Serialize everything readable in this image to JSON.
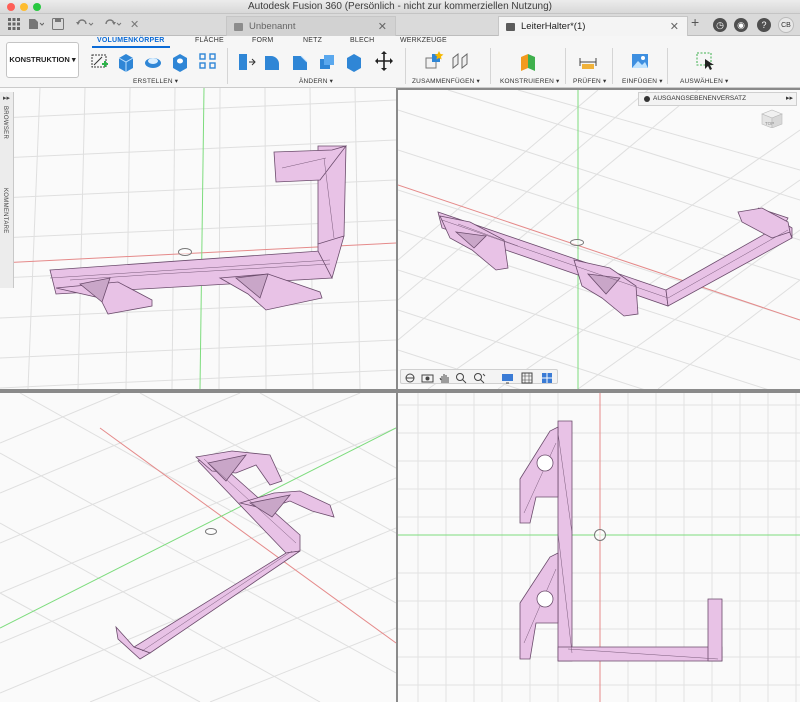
{
  "window": {
    "title": "Autodesk Fusion 360 (Persönlich - nicht zur kommerziellen Nutzung)"
  },
  "tabs": [
    {
      "label": "Unbenannt",
      "active": false
    },
    {
      "label": "LeiterHalter*(1)",
      "active": true
    }
  ],
  "user": {
    "initials": "CB"
  },
  "ribbon": {
    "workspace": "KONSTRUKTION",
    "tabs": [
      {
        "label": "VOLUMENKÖRPER",
        "active": true
      },
      {
        "label": "FLÄCHE"
      },
      {
        "label": "FORM"
      },
      {
        "label": "NETZ"
      },
      {
        "label": "BLECH"
      },
      {
        "label": "WERKZEUGE"
      }
    ],
    "groups": {
      "erstellen": "ERSTELLEN",
      "aendern": "ÄNDERN",
      "zusammenfuegen": "ZUSAMMENFÜGEN",
      "konstruieren": "KONSTRUIEREN",
      "pruefen": "PRÜFEN",
      "einfuegen": "EINFÜGEN",
      "auswaehlen": "AUSWÄHLEN"
    }
  },
  "side": {
    "browser": "BROWSER",
    "kommentare": "KOMMENTARE"
  },
  "param_panel": {
    "label": "AUSGANGSEBENENVERSATZ"
  },
  "viewcube": {
    "label": "TOP"
  },
  "colors": {
    "mesh_fill": "#e8c2e6",
    "mesh_edge": "#6b4c6c",
    "axis_x": "#e08080",
    "axis_y": "#6fd96f",
    "grid": "#dcdcdc",
    "accent": "#0a6ad6"
  }
}
